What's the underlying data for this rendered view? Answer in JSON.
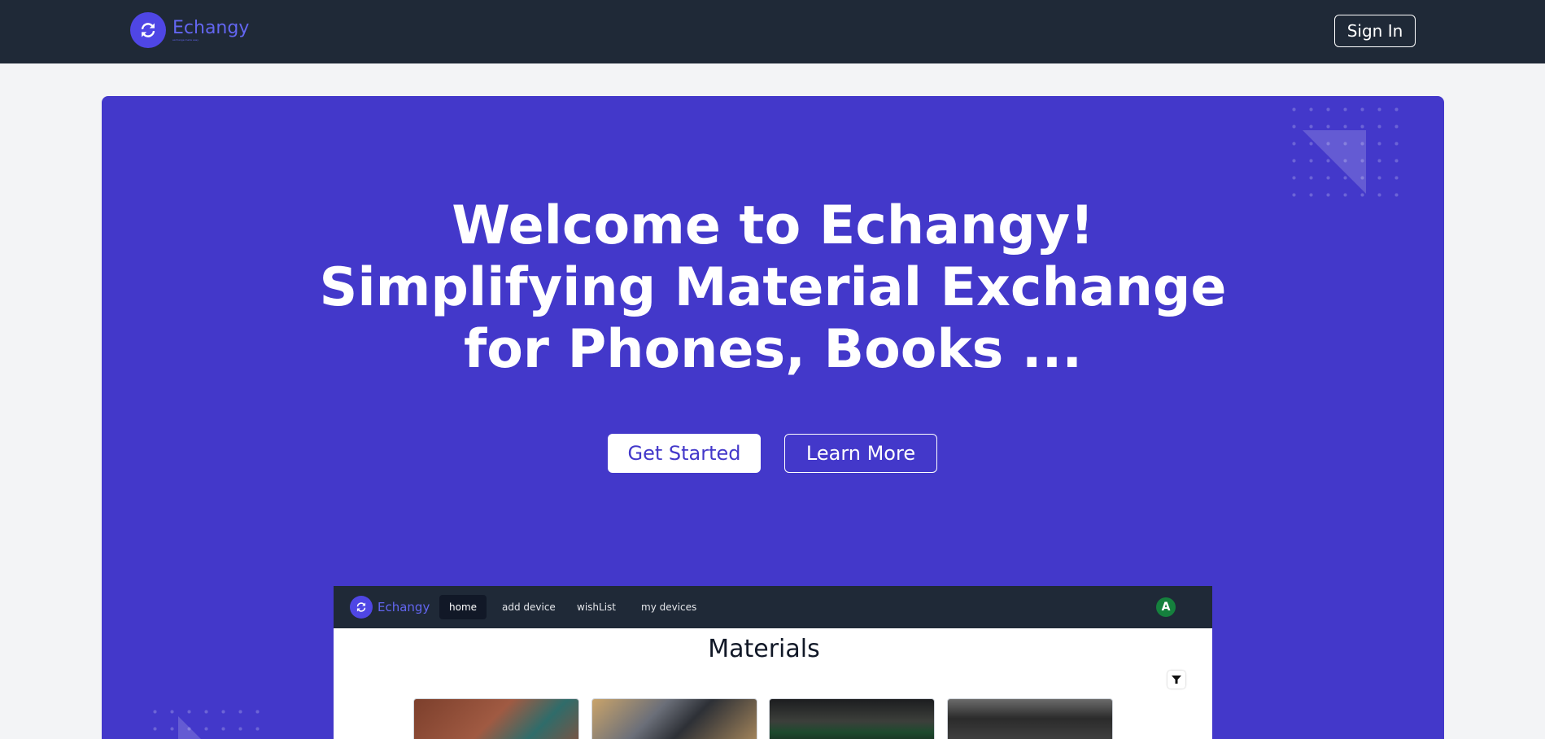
{
  "header": {
    "brand": "Echangy",
    "tagline": "exchange made easy",
    "sign_in_label": "Sign In"
  },
  "hero": {
    "headline_lines": [
      "Welcome to Echangy!",
      "Simplifying Material Exchange",
      "for Phones, Books ..."
    ],
    "primary_button": "Get Started",
    "secondary_button": "Learn More"
  },
  "preview": {
    "brand": "Echangy",
    "tabs": [
      {
        "label": "home",
        "active": true
      },
      {
        "label": "add device",
        "active": false
      },
      {
        "label": "wishList",
        "active": false
      },
      {
        "label": "my devices",
        "active": false
      }
    ],
    "avatar_initial": "A",
    "title": "Materials"
  },
  "colors": {
    "nav_bg": "#1f2937",
    "hero_bg": "#4338ca",
    "accent": "#6366f1",
    "avatar_bg": "#15803d"
  },
  "icons": {
    "logo": "refresh-arrows-icon",
    "filter": "funnel-icon"
  }
}
